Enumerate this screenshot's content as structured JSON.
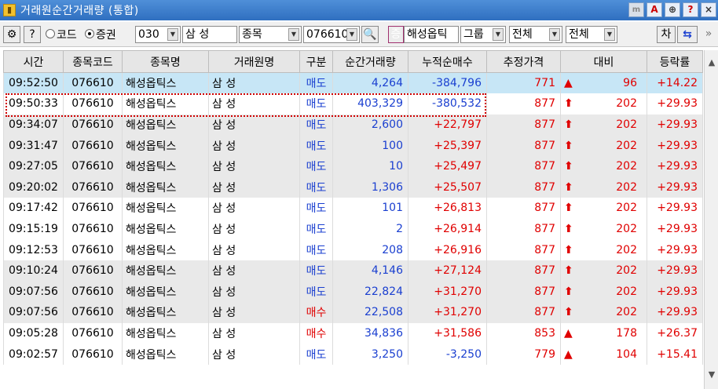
{
  "window": {
    "title": "거래원순간거래량 (통합)",
    "title_buttons": [
      "m",
      "A",
      "⊕",
      "?",
      "×"
    ]
  },
  "toolbar": {
    "settings_icon": "gear-icon",
    "help_label": "?",
    "radio_code": "코드",
    "radio_broker": "증권",
    "broker_code": "030",
    "broker_name": "삼   성",
    "item_type": "종목",
    "stock_code": "076610",
    "search_icon": "search-icon",
    "jeung_label": "증",
    "stock_name": "해성옵틱",
    "group_label": "그룹",
    "filter1": "전체",
    "filter2": "전체",
    "cha_label": "차",
    "swap_icon": "swap-icon"
  },
  "table": {
    "columns": [
      "시간",
      "종목코드",
      "종목명",
      "거래원명",
      "구분",
      "순간거래량",
      "누적순매수",
      "추정가격",
      "대비",
      "등락률"
    ],
    "rows": [
      {
        "time": "09:52:50",
        "code": "076610",
        "name": "해성옵틱스",
        "broker": "삼   성",
        "side": "매도",
        "side_color": "blue",
        "vol": "4,264",
        "net": "-384,796",
        "price": "771",
        "arrow": "▲",
        "diff": "96",
        "rate": "+14.22"
      },
      {
        "time": "09:50:33",
        "code": "076610",
        "name": "해성옵틱스",
        "broker": "삼   성",
        "side": "매도",
        "side_color": "blue",
        "vol": "403,329",
        "net": "-380,532",
        "price": "877",
        "arrow": "⬆",
        "diff": "202",
        "rate": "+29.93"
      },
      {
        "time": "09:34:07",
        "code": "076610",
        "name": "해성옵틱스",
        "broker": "삼   성",
        "side": "매도",
        "side_color": "blue",
        "vol": "2,600",
        "net": "+22,797",
        "price": "877",
        "arrow": "⬆",
        "diff": "202",
        "rate": "+29.93"
      },
      {
        "time": "09:31:47",
        "code": "076610",
        "name": "해성옵틱스",
        "broker": "삼   성",
        "side": "매도",
        "side_color": "blue",
        "vol": "100",
        "net": "+25,397",
        "price": "877",
        "arrow": "⬆",
        "diff": "202",
        "rate": "+29.93"
      },
      {
        "time": "09:27:05",
        "code": "076610",
        "name": "해성옵틱스",
        "broker": "삼   성",
        "side": "매도",
        "side_color": "blue",
        "vol": "10",
        "net": "+25,497",
        "price": "877",
        "arrow": "⬆",
        "diff": "202",
        "rate": "+29.93"
      },
      {
        "time": "09:20:02",
        "code": "076610",
        "name": "해성옵틱스",
        "broker": "삼   성",
        "side": "매도",
        "side_color": "blue",
        "vol": "1,306",
        "net": "+25,507",
        "price": "877",
        "arrow": "⬆",
        "diff": "202",
        "rate": "+29.93"
      },
      {
        "time": "09:17:42",
        "code": "076610",
        "name": "해성옵틱스",
        "broker": "삼   성",
        "side": "매도",
        "side_color": "blue",
        "vol": "101",
        "net": "+26,813",
        "price": "877",
        "arrow": "⬆",
        "diff": "202",
        "rate": "+29.93"
      },
      {
        "time": "09:15:19",
        "code": "076610",
        "name": "해성옵틱스",
        "broker": "삼   성",
        "side": "매도",
        "side_color": "blue",
        "vol": "2",
        "net": "+26,914",
        "price": "877",
        "arrow": "⬆",
        "diff": "202",
        "rate": "+29.93"
      },
      {
        "time": "09:12:53",
        "code": "076610",
        "name": "해성옵틱스",
        "broker": "삼   성",
        "side": "매도",
        "side_color": "blue",
        "vol": "208",
        "net": "+26,916",
        "price": "877",
        "arrow": "⬆",
        "diff": "202",
        "rate": "+29.93"
      },
      {
        "time": "09:10:24",
        "code": "076610",
        "name": "해성옵틱스",
        "broker": "삼   성",
        "side": "매도",
        "side_color": "blue",
        "vol": "4,146",
        "net": "+27,124",
        "price": "877",
        "arrow": "⬆",
        "diff": "202",
        "rate": "+29.93"
      },
      {
        "time": "09:07:56",
        "code": "076610",
        "name": "해성옵틱스",
        "broker": "삼   성",
        "side": "매도",
        "side_color": "blue",
        "vol": "22,824",
        "net": "+31,270",
        "price": "877",
        "arrow": "⬆",
        "diff": "202",
        "rate": "+29.93"
      },
      {
        "time": "09:07:56",
        "code": "076610",
        "name": "해성옵틱스",
        "broker": "삼   성",
        "side": "매수",
        "side_color": "red",
        "vol": "22,508",
        "net": "+31,270",
        "price": "877",
        "arrow": "⬆",
        "diff": "202",
        "rate": "+29.93"
      },
      {
        "time": "09:05:28",
        "code": "076610",
        "name": "해성옵틱스",
        "broker": "삼   성",
        "side": "매수",
        "side_color": "red",
        "vol": "34,836",
        "net": "+31,586",
        "price": "853",
        "arrow": "▲",
        "diff": "178",
        "rate": "+26.37"
      },
      {
        "time": "09:02:57",
        "code": "076610",
        "name": "해성옵틱스",
        "broker": "삼   성",
        "side": "매도",
        "side_color": "blue",
        "vol": "3,250",
        "net": "-3,250",
        "price": "779",
        "arrow": "▲",
        "diff": "104",
        "rate": "+15.41"
      }
    ]
  },
  "colors": {
    "buy": "#e00000",
    "sell": "#1a3fd0",
    "selected_row": "#c7e6f6",
    "alt_row": "#e9e9e9",
    "highlight_border": "#d00000"
  }
}
